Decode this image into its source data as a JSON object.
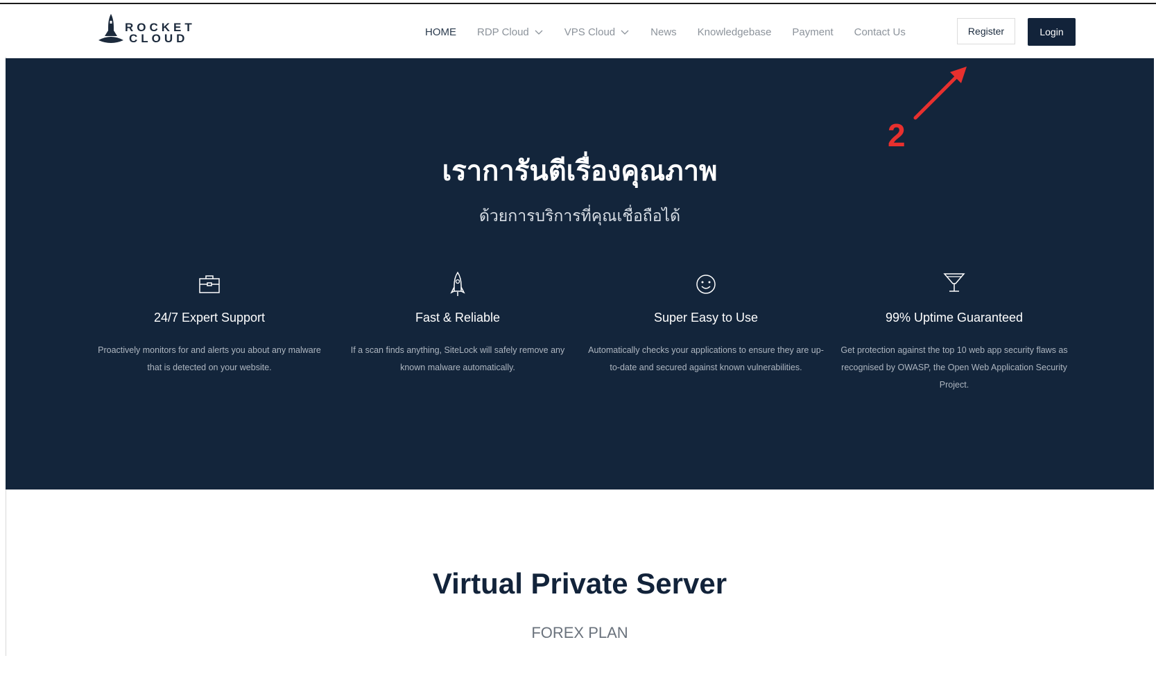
{
  "header": {
    "logo": {
      "line1": "ROCKET",
      "line2": "CLOUD",
      "icon": "rocket-icon"
    },
    "nav": [
      {
        "label": "HOME",
        "active": true,
        "dropdown": false
      },
      {
        "label": "RDP Cloud",
        "active": false,
        "dropdown": true
      },
      {
        "label": "VPS Cloud",
        "active": false,
        "dropdown": true
      },
      {
        "label": "News",
        "active": false,
        "dropdown": false
      },
      {
        "label": "Knowledgebase",
        "active": false,
        "dropdown": false
      },
      {
        "label": "Payment",
        "active": false,
        "dropdown": false
      },
      {
        "label": "Contact Us",
        "active": false,
        "dropdown": false
      }
    ],
    "register_label": "Register",
    "login_label": "Login"
  },
  "hero": {
    "title": "เราการันตีเรื่องคุณภาพ",
    "subtitle": "ด้วยการบริการที่คุณเชื่อถือได้",
    "features": [
      {
        "icon": "briefcase-icon",
        "title": "24/7 Expert Support",
        "desc": "Proactively monitors for and alerts you about any malware that is detected on your website."
      },
      {
        "icon": "rocket-icon",
        "title": "Fast & Reliable",
        "desc": "If a scan finds anything, SiteLock will safely remove any known malware automatically."
      },
      {
        "icon": "smiley-icon",
        "title": "Super Easy to Use",
        "desc": "Automatically checks your applications to ensure they are up-to-date and secured against known vulnerabilities."
      },
      {
        "icon": "trophy-icon",
        "title": "99% Uptime Guaranteed",
        "desc": "Get protection against the top 10 web app security flaws as recognised by OWASP, the Open Web Application Security Project."
      }
    ]
  },
  "annotation": {
    "number": "2",
    "color": "#e8302e"
  },
  "vps_section": {
    "title": "Virtual Private Server",
    "subtitle": "FOREX PLAN"
  },
  "colors": {
    "navy": "#13253b",
    "accent_red": "#e8302e",
    "nav_text": "#8c939b"
  }
}
